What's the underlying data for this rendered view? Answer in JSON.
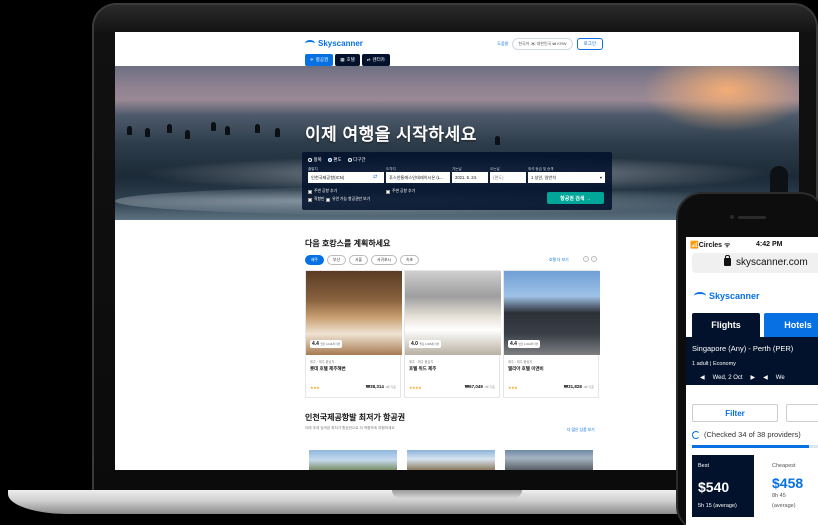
{
  "desktop": {
    "header": {
      "logo": "Skyscanner",
      "help": "도움말",
      "locale": "한국어 🇰🇷 대한민국 ₩ KRW",
      "login": "로그인"
    },
    "nav_tabs": [
      {
        "icon": "✈",
        "label": "항공권"
      },
      {
        "icon": "▦",
        "label": "호텔"
      },
      {
        "icon": "⇌",
        "label": "렌터카"
      }
    ],
    "hero_title": "이제 여행을 시작하세요",
    "search": {
      "trip_types": [
        "왕복",
        "편도",
        "다구간"
      ],
      "labels": {
        "origin": "출발지",
        "destination": "도착지",
        "depart": "가는날",
        "return": "오는날",
        "cabin": "좌석 등급 및 승객"
      },
      "origin": "인천국제공항(ICN)",
      "destination": "푸스안통에스인데레이시온 (L...",
      "depart": "2021. 5. 24.",
      "return": "(편도)",
      "cabin": "1 성인, 일반석",
      "checks": [
        "주변 공항 추가",
        "주변 공항 추가",
        "직항만",
        "유연 가능 항공권만 보기"
      ],
      "button": "항공권 검색 →"
    },
    "hotels_section": {
      "title": "다음 호캉스를 계획하세요",
      "cities": [
        "제주",
        "부산",
        "서울",
        "서귀포시",
        "속초"
      ],
      "more": "호텔 더 보기",
      "pager": [
        "‹",
        "›"
      ],
      "cards": [
        {
          "score": "4.4",
          "score_label": "멋진 4,116개 리뷰",
          "location": "제주 · 제주 중심지",
          "name": "롯데 호텔 제주해변",
          "stars": "★★★",
          "price": "₩38,314",
          "per_night": "1박 기준"
        },
        {
          "score": "4.0",
          "score_label": "좋음 1,025개 리뷰",
          "location": "제주 · 제주 중심지",
          "name": "호텔 위드 제주",
          "stars": "★★★★",
          "price": "₩67,049",
          "per_night": "1박 기준"
        },
        {
          "score": "4.4",
          "score_label": "멋진 1,022개 리뷰",
          "location": "제주 · 제주 중심지",
          "name": "앨리아 호텔 이앤비",
          "stars": "★★★",
          "price": "₩31,828",
          "per_night": "1박 기준"
        }
      ]
    },
    "flights_section": {
      "title": "인천국제공항발 최저가 항공권",
      "subtitle": "아래 추세 검색된 최저가 항공권으로 더 적합하게 여행하세요",
      "more": "더 많은 상품 보기"
    }
  },
  "mobile": {
    "status": {
      "carrier": "📶Circles ᯤ",
      "time": "4:42 PM"
    },
    "url": "skyscanner.com",
    "logo": "Skyscanner",
    "tabs": [
      "Flights",
      "Hotels"
    ],
    "route": "Singapore (Any) - Perth (PER)",
    "pax": "1 adult | Economy",
    "dates": [
      "◀",
      "Wed, 2 Oct",
      "▶",
      "◀",
      "We"
    ],
    "filter": "Filter",
    "progress_text": "(Checked 34 of 38 providers)",
    "progress": 0.89,
    "best": {
      "label": "Best",
      "price": "$540",
      "duration": "5h 15 (average)"
    },
    "cheapest": {
      "label": "Cheapest",
      "price": "$458",
      "duration": "8h 45",
      "note": "(average)"
    }
  },
  "colors": {
    "brand_blue": "#0770e3",
    "navy": "#02122c",
    "teal_button": "#00a698",
    "star_gold": "#f5a623"
  }
}
